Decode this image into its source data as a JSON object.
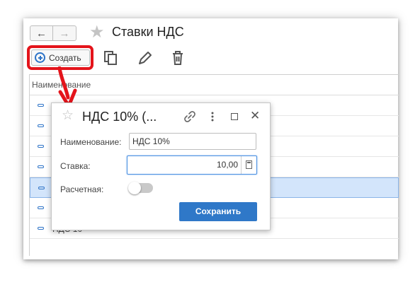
{
  "window": {
    "title": "Ставки НДС",
    "nav": {
      "back_icon": "arrow-left-icon",
      "forward_icon": "arrow-right-icon"
    }
  },
  "toolbar": {
    "create_label": "Создать",
    "highlight_color": "#e4141b",
    "icons": [
      "plus-circle-icon",
      "copy-icon",
      "pencil-icon",
      "trash-icon"
    ]
  },
  "table": {
    "column_header": "Наименование",
    "rows": [
      {
        "label": ""
      },
      {
        "label": ""
      },
      {
        "label": ""
      },
      {
        "label": ""
      },
      {
        "label": "",
        "selected": true
      },
      {
        "label": ""
      },
      {
        "label": "НДС 10"
      }
    ]
  },
  "dialog": {
    "title": "НДС 10% (...",
    "fields": {
      "name_label": "Наименование:",
      "name_value": "НДС 10%",
      "rate_label": "Ставка:",
      "rate_value": "10,00",
      "calculated_label": "Расчетная:",
      "calculated_on": false
    },
    "save_label": "Сохранить",
    "accent_color": "#2f78c8"
  }
}
